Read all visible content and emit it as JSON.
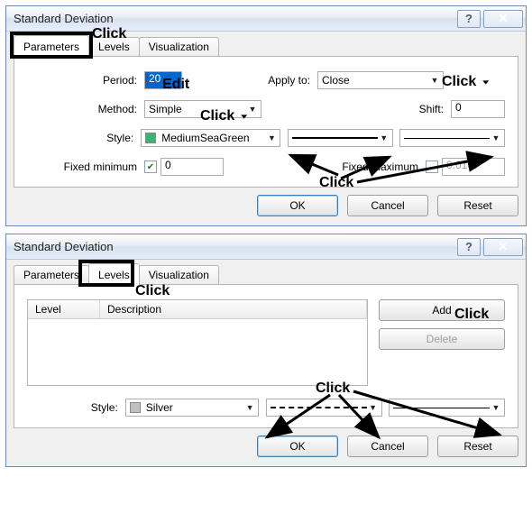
{
  "dialog1": {
    "title": "Standard Deviation",
    "tabs": {
      "parameters": "Parameters",
      "levels": "Levels",
      "visualization": "Visualization"
    },
    "period_label": "Period:",
    "period_value": "20",
    "apply_label": "Apply to:",
    "apply_value": "Close",
    "method_label": "Method:",
    "method_value": "Simple",
    "shift_label": "Shift:",
    "shift_value": "0",
    "style_label": "Style:",
    "style_value": "MediumSeaGreen",
    "fixed_min_label": "Fixed minimum",
    "fixed_min_value": "0",
    "fixed_max_label": "Fixed maximum",
    "fixed_max_value": "0.0147",
    "ok": "OK",
    "cancel": "Cancel",
    "reset": "Reset"
  },
  "dialog2": {
    "title": "Standard Deviation",
    "tabs": {
      "parameters": "Parameters",
      "levels": "Levels",
      "visualization": "Visualization"
    },
    "level_col": "Level",
    "desc_col": "Description",
    "add": "Add",
    "delete": "Delete",
    "style_label": "Style:",
    "style_value": "Silver",
    "ok": "OK",
    "cancel": "Cancel",
    "reset": "Reset"
  },
  "ann": {
    "click": "Click",
    "edit": "Edit"
  },
  "colors": {
    "mediumseagreen": "#3cb371",
    "silver": "#c0c0c0"
  }
}
